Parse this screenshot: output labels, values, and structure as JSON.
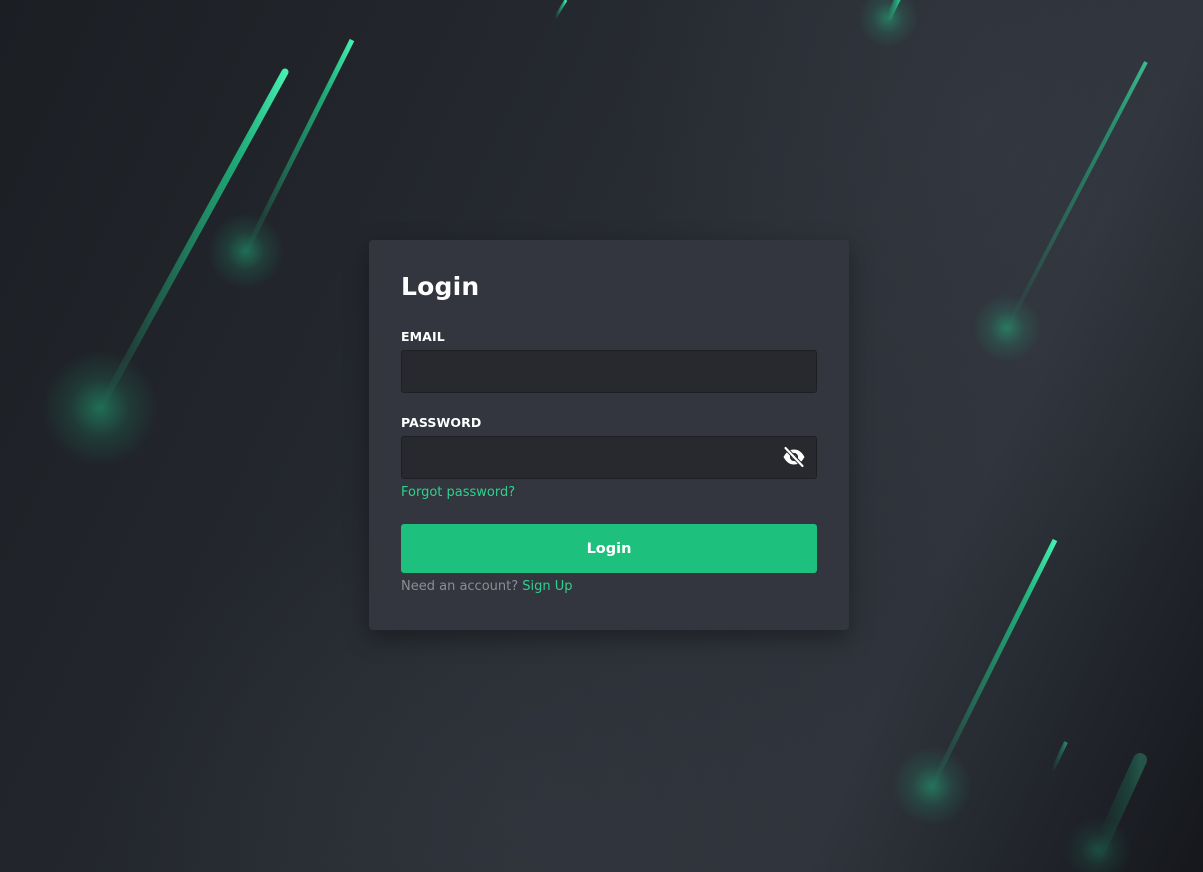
{
  "colors": {
    "accent": "#1ec07d",
    "link": "#2fd08e",
    "card": "#33363e",
    "input": "#27292e",
    "meteor": "#1fe59a"
  },
  "login": {
    "title": "Login",
    "email": {
      "label": "EMAIL",
      "value": "",
      "placeholder": ""
    },
    "password": {
      "label": "PASSWORD",
      "value": "",
      "placeholder": "",
      "toggle_icon": "eye-off-icon"
    },
    "forgot_label": "Forgot password?",
    "submit_label": "Login",
    "signup_prompt": "Need an account?",
    "signup_label": "Sign Up"
  }
}
